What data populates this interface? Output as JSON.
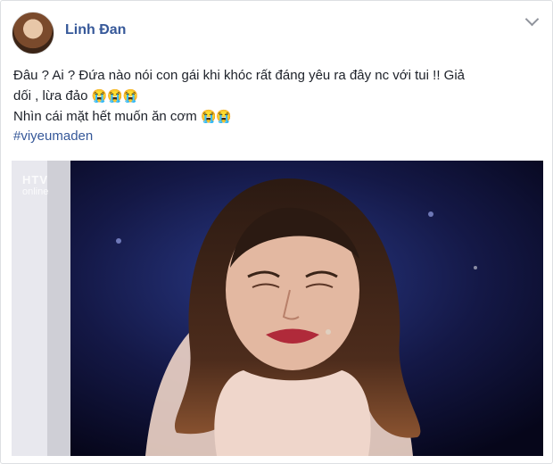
{
  "post": {
    "author_name": "Linh Đan",
    "text_lines": [
      "Đâu ? Ai ? Đứa nào nói con gái khi khóc rất đáng yêu ra đây nc với tui !! Giả",
      "dối , lừa đảo",
      "Nhìn cái mặt hết muốn ăn cơm"
    ],
    "emoji": {
      "line2": "😭😭😭",
      "line3": "😭😭"
    },
    "hashtag": "#viyeumaden"
  },
  "media": {
    "watermark_top": "HTV",
    "watermark_bottom": "online"
  },
  "icons": {
    "avatar": "profile-avatar",
    "menu": "chevron-down-icon",
    "emoji": "loudly-crying-face-icon"
  },
  "colors": {
    "author": "#365899",
    "hashtag": "#365899",
    "text": "#1d2129"
  }
}
